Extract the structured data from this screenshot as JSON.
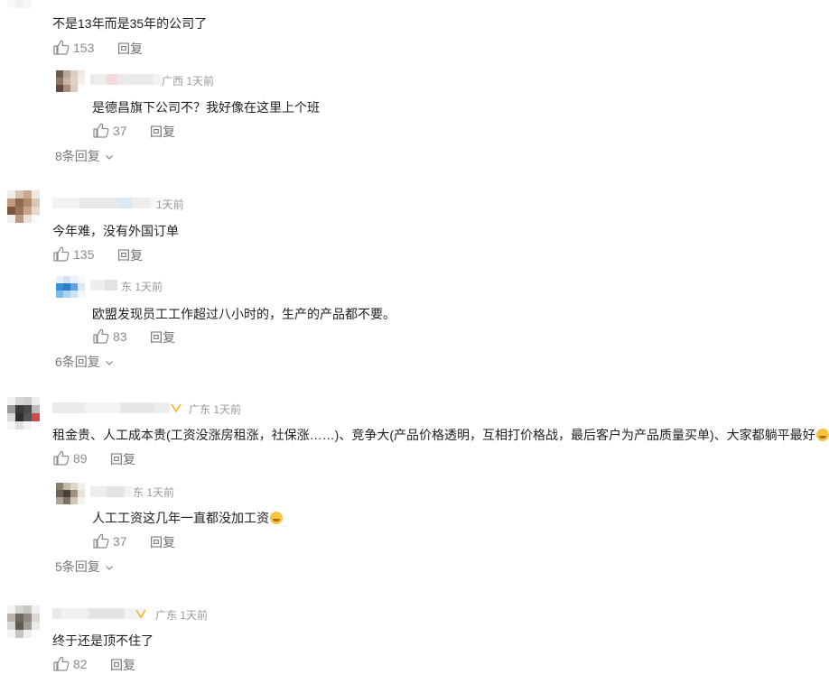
{
  "comments": [
    {
      "text": "不是13年而是35年的公司了",
      "likes": "153",
      "reply_label": "回复",
      "reply": {
        "meta": "广西 1天前",
        "text": "是德昌旗下公司不？我好像在这里上个班",
        "likes": "37",
        "reply_label": "回复"
      },
      "more_replies": "8条回复"
    },
    {
      "meta": "1天前",
      "text": "今年难，没有外国订单",
      "likes": "135",
      "reply_label": "回复",
      "reply": {
        "meta": "东 1天前",
        "text": "欧盟发现员工工作超过八小时的，生产的产品都不要。",
        "likes": "83",
        "reply_label": "回复"
      },
      "more_replies": "6条回复"
    },
    {
      "meta": "广东 1天前",
      "text": "租金贵、人工成本贵(工资没涨房租涨，社保涨……)、竞争大(产品价格透明，互相打价格战，最后客户为产品质量买单)、大家都躺平最好",
      "likes": "89",
      "reply_label": "回复",
      "reply": {
        "meta": "东 1天前",
        "text": "人工工资这几年一直都没加工资",
        "likes": "37",
        "reply_label": "回复"
      },
      "more_replies": "5条回复"
    },
    {
      "meta": "广东 1天前",
      "text": "终于还是顶不住了",
      "likes": "82",
      "reply_label": "回复"
    }
  ],
  "icons": {
    "like": "thumbs-up-icon",
    "chevron": "chevron-down-icon"
  },
  "colors": {
    "text": "#1f1f1f",
    "meta": "#9a9a9a",
    "icon": "#8a8a8a"
  }
}
